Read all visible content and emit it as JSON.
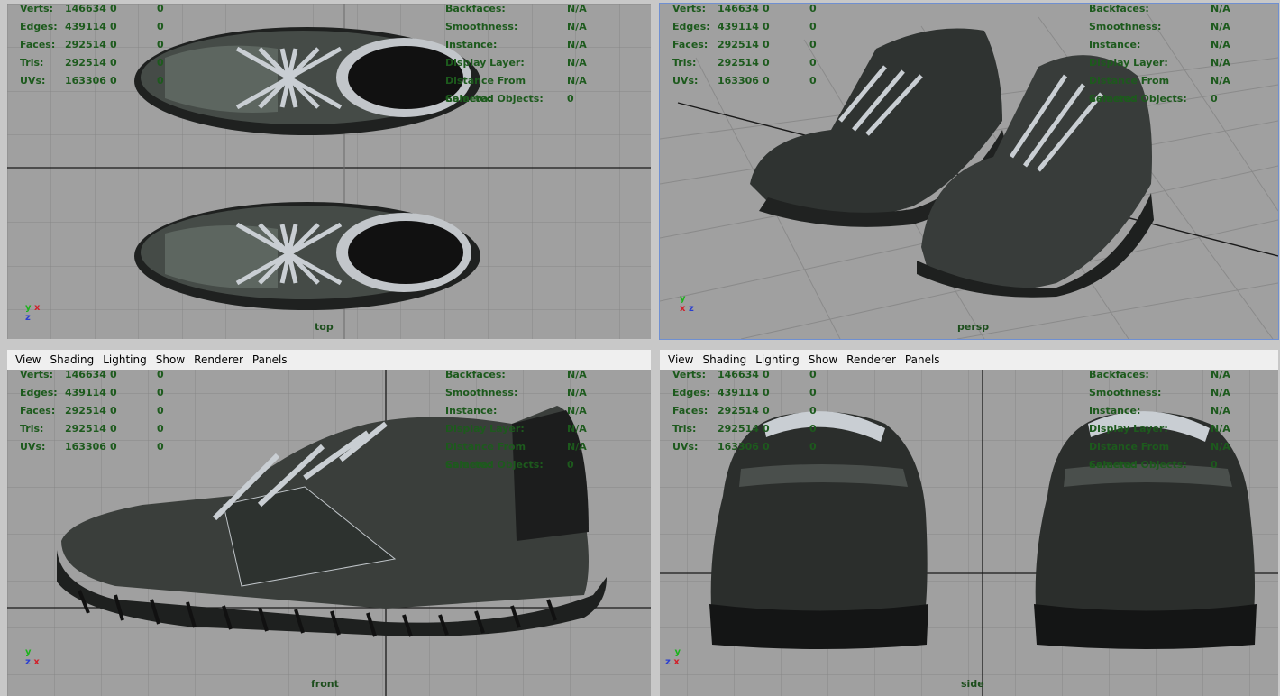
{
  "menu": [
    "View",
    "Shading",
    "Lighting",
    "Show",
    "Renderer",
    "Panels"
  ],
  "stats_left": [
    {
      "label": "Verts:",
      "v1": "146634",
      "v2": "0",
      "v3": "0"
    },
    {
      "label": "Edges:",
      "v1": "439114",
      "v2": "0",
      "v3": "0"
    },
    {
      "label": "Faces:",
      "v1": "292514",
      "v2": "0",
      "v3": "0"
    },
    {
      "label": "Tris:",
      "v1": "292514",
      "v2": "0",
      "v3": "0"
    },
    {
      "label": "UVs:",
      "v1": "163306",
      "v2": "0",
      "v3": "0"
    }
  ],
  "stats_right": [
    {
      "label": "Backfaces:",
      "value": "N/A"
    },
    {
      "label": "Smoothness:",
      "value": "N/A"
    },
    {
      "label": "Instance:",
      "value": "N/A"
    },
    {
      "label": "Display Layer:",
      "value": "N/A"
    },
    {
      "label": "Distance From Camera:",
      "value": "N/A"
    },
    {
      "label": "Selected Objects:",
      "value": "0"
    }
  ],
  "viewports": {
    "top": {
      "camera": "top"
    },
    "persp": {
      "camera": "persp"
    },
    "front": {
      "camera": "front"
    },
    "side": {
      "camera": "side"
    }
  },
  "axes": {
    "x": "x",
    "y": "y",
    "z": "z"
  },
  "colors": {
    "viewport_bg": "#a0a0a0",
    "hud_green": "#1d5a1d",
    "shoe_dark": "#2b2e2c",
    "lace": "#c9ced3"
  }
}
